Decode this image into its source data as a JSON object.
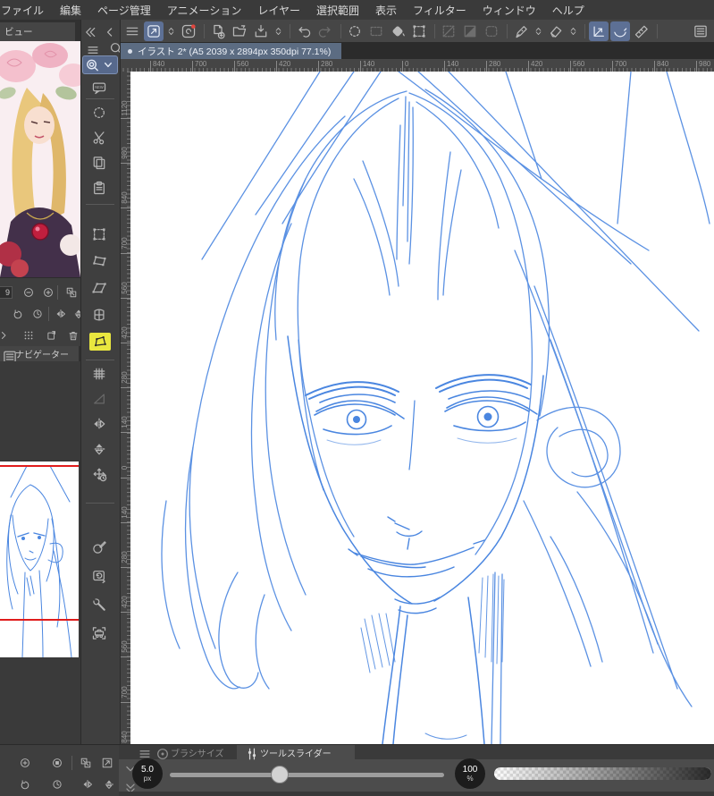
{
  "menu_bar": {
    "items": [
      "ファイル",
      "編集",
      "ページ管理",
      "アニメーション",
      "レイヤー",
      "選択範囲",
      "表示",
      "フィルター",
      "ウィンドウ",
      "ヘルプ"
    ]
  },
  "toolbar": {
    "items": [
      {
        "icon": "menu"
      },
      {
        "icon": "object-tool",
        "active": true
      },
      {
        "icon": "chevrons",
        "narrow": true
      },
      {
        "icon": "clip-studio"
      },
      {
        "divider": true
      },
      {
        "icon": "new-file"
      },
      {
        "icon": "open-file"
      },
      {
        "icon": "save-file"
      },
      {
        "icon": "chevrons",
        "narrow": true
      },
      {
        "divider": true
      },
      {
        "icon": "undo"
      },
      {
        "icon": "redo",
        "disabled": true
      },
      {
        "divider": true
      },
      {
        "icon": "select-refresh"
      },
      {
        "icon": "deselect",
        "disabled": true
      },
      {
        "icon": "fill-area"
      },
      {
        "icon": "transform-frame"
      },
      {
        "divider": true
      },
      {
        "icon": "straight-line",
        "disabled": true
      },
      {
        "icon": "gradient",
        "disabled": true
      },
      {
        "icon": "frame-border",
        "disabled": true
      },
      {
        "divider": true
      },
      {
        "icon": "pen"
      },
      {
        "icon": "chevrons",
        "narrow": true
      },
      {
        "icon": "eraser"
      },
      {
        "icon": "chevrons",
        "narrow": true
      },
      {
        "divider": true
      },
      {
        "icon": "snap-ruler-angle",
        "active": true
      },
      {
        "icon": "snap-curve",
        "active": true
      },
      {
        "icon": "snap-special-ruler"
      },
      {
        "divider": true
      }
    ],
    "right_icon": "layer-panel"
  },
  "document_tab": {
    "title": "イラスト 2* (A5 2039 x 2894px 350dpi 77.1%)"
  },
  "rulers": {
    "horizontal_labels": [
      "840",
      "700",
      "560",
      "420",
      "280",
      "140",
      "0",
      "140",
      "280",
      "420",
      "560",
      "700",
      "840",
      "980"
    ],
    "vertical_labels": [
      "1120",
      "980",
      "840",
      "700",
      "560",
      "420",
      "280",
      "140",
      "0",
      "140",
      "280",
      "420",
      "560",
      "700",
      "840"
    ]
  },
  "left_strip": {
    "items": [
      {
        "icon": "comment-new"
      },
      {
        "divider": true
      },
      {
        "icon": "select-refresh"
      },
      {
        "icon": "scissors"
      },
      {
        "icon": "copy"
      },
      {
        "icon": "paste"
      },
      {
        "divider": true
      },
      {
        "icon": "transform-frame"
      },
      {
        "icon": "distort"
      },
      {
        "icon": "skew"
      },
      {
        "icon": "mesh"
      },
      {
        "icon": "perspective",
        "yellow": true
      },
      {
        "divider": true
      },
      {
        "icon": "grid"
      },
      {
        "icon": "tri-gradient",
        "disabled": true
      },
      {
        "icon": "flip-h"
      },
      {
        "icon": "flip-v"
      },
      {
        "icon": "move-clock"
      },
      {
        "divider": true
      },
      {
        "icon": "decoration"
      },
      {
        "icon": "window-sync"
      },
      {
        "icon": "wrench"
      },
      {
        "icon": "camera"
      }
    ]
  },
  "subview": {
    "tab_label": "ビュー"
  },
  "navigator": {
    "tab_label": "ナビゲーター",
    "zoom_value": "9",
    "controls_mid": [
      [
        {
          "value": "9"
        },
        {
          "icon": "zoom-out"
        },
        {
          "icon": "zoom-in"
        },
        {
          "divider": true
        },
        {
          "icon": "fit-screen"
        }
      ],
      [
        {
          "icon": "rotate-left"
        },
        {
          "icon": "rotate-reset"
        },
        {
          "divider": true
        },
        {
          "icon": "flip-h"
        },
        {
          "icon": "flip-v"
        }
      ],
      [
        {
          "icon": "chevron-right"
        },
        {
          "icon": "dots-grid"
        },
        {
          "icon": "duplicate-view"
        },
        {
          "icon": "trash"
        }
      ]
    ],
    "controls_bottom": [
      [
        {
          "icon": "zoom-in-alt"
        },
        {
          "icon": "stop-circle"
        },
        {
          "divider": true
        },
        {
          "icon": "fit-screen"
        },
        {
          "icon": "expand-view"
        }
      ],
      [
        {
          "icon": "rotate-left"
        },
        {
          "icon": "rotate-reset"
        },
        {
          "icon": "flip-h"
        },
        {
          "icon": "flip-v"
        }
      ]
    ]
  },
  "tool_slider_panel": {
    "tabs": [
      {
        "label": "ブラシサイズ",
        "icon": "brush-size",
        "active": false
      },
      {
        "label": "ツールスライダー",
        "icon": "tool-slider",
        "active": true
      }
    ],
    "sliders": [
      {
        "value": "5.0",
        "unit": "px",
        "percent": 40
      },
      {
        "value": "100",
        "unit": "%"
      }
    ]
  },
  "colors": {
    "sketch_blue": "#4a86e0",
    "accent_blue": "#5d7095",
    "tab_blue": "#5c6c82",
    "highlight_yellow": "#e9e73f",
    "guide_red": "#e01c1c"
  }
}
